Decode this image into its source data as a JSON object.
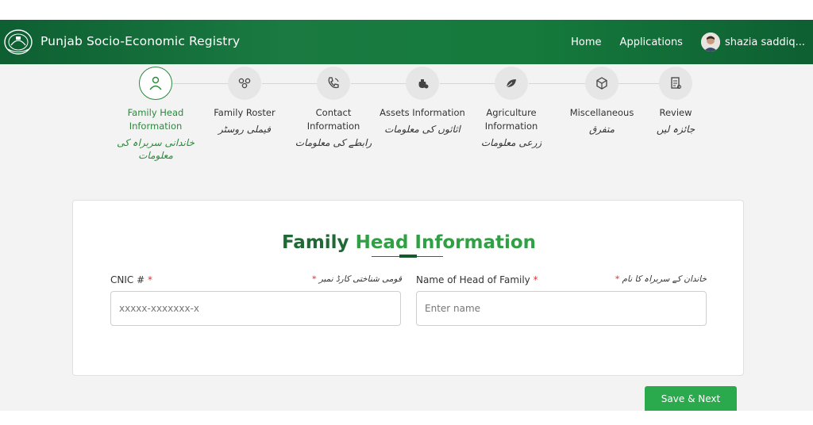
{
  "header": {
    "brand": "Punjab Socio-Economic Registry",
    "nav": {
      "home": "Home",
      "applications": "Applications"
    },
    "user": {
      "name": "shazia saddiq..."
    }
  },
  "steps": [
    {
      "label": "Family Head Information",
      "urdu": "خاندانی سربراہ کی معلومات",
      "icon": "person-icon",
      "active": true
    },
    {
      "label": "Family Roster",
      "urdu": "فیملی روسٹر",
      "icon": "family-icon",
      "active": false
    },
    {
      "label": "Contact Information",
      "urdu": "رابطے کی معلومات",
      "icon": "phone-icon",
      "active": false
    },
    {
      "label": "Assets Information",
      "urdu": "اثاثوں کی معلومات",
      "icon": "assets-icon",
      "active": false
    },
    {
      "label": "Agriculture Information",
      "urdu": "زرعی معلومات",
      "icon": "leaf-icon",
      "active": false
    },
    {
      "label": "Miscellaneous",
      "urdu": "متفرق",
      "icon": "cube-icon",
      "active": false
    },
    {
      "label": "Review",
      "urdu": "جائزہ لیں",
      "icon": "document-icon",
      "active": false
    }
  ],
  "form": {
    "title_part1": "Family",
    "title_part2": "Head Information",
    "cnic": {
      "label": "CNIC #",
      "required": "*",
      "urdu": "قومی شناختی کارڈ نمبر",
      "placeholder": "xxxxx-xxxxxxx-x",
      "value": ""
    },
    "name": {
      "label": "Name of Head of Family",
      "required": "*",
      "urdu": "خاندان کے سربراہ کا نام",
      "placeholder": "Enter name",
      "value": ""
    }
  },
  "actions": {
    "save_next": "Save & Next"
  },
  "colors": {
    "header": "#1a7a41",
    "accent": "#2fa043",
    "button": "#2aa94d"
  }
}
